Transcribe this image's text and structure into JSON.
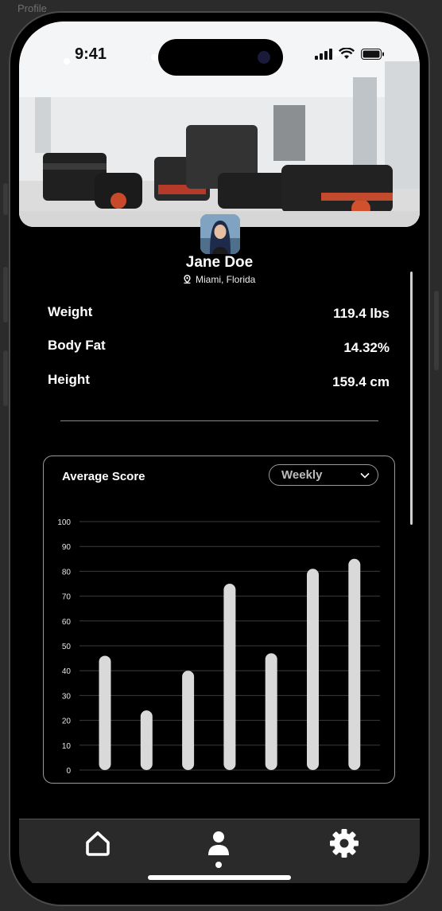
{
  "frame_label": "Profile",
  "status_bar": {
    "time": "9:41"
  },
  "profile": {
    "name": "Jane Doe",
    "location": "Miami, Florida"
  },
  "stats": [
    {
      "label": "Weight",
      "value": "119.4 lbs"
    },
    {
      "label": "Body Fat",
      "value": "14.32%"
    },
    {
      "label": "Height",
      "value": "159.4 cm"
    }
  ],
  "score_card": {
    "title": "Average Score",
    "period_selected": "Weekly"
  },
  "chart_data": {
    "type": "bar",
    "title": "Average Score",
    "categories": [
      "",
      "",
      "",
      "",
      "",
      "",
      ""
    ],
    "values": [
      46,
      24,
      40,
      75,
      47,
      81,
      85
    ],
    "ylim": [
      0,
      100
    ],
    "yticks": [
      "100",
      "90",
      "80",
      "70",
      "60",
      "50",
      "40",
      "30",
      "20",
      "10",
      "0"
    ],
    "grid": true,
    "bar_color": "#d9d9d9"
  },
  "tabbar": {
    "items": [
      "home-icon",
      "profile-icon",
      "settings-icon"
    ],
    "active": "profile-icon"
  }
}
